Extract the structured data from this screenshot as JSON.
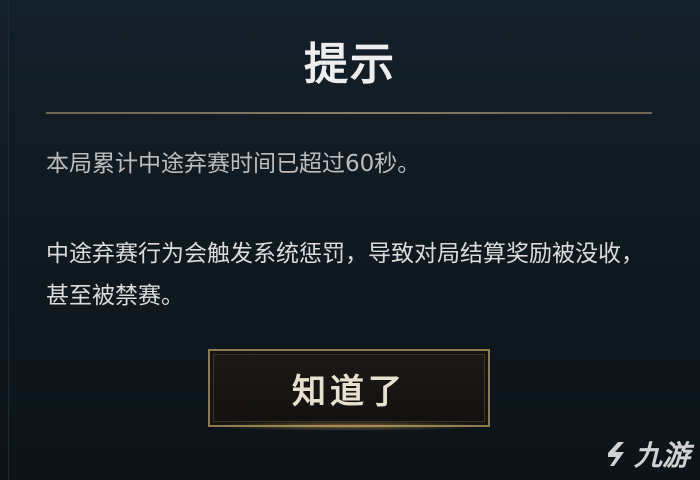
{
  "dialog": {
    "title": "提示",
    "paragraphs": [
      "本局累计中途弃赛时间已超过60秒。",
      "中途弃赛行为会触发系统惩罚，导致对局结算奖励被没收，甚至被禁赛。"
    ],
    "confirm_label": "知道了"
  },
  "watermark": {
    "text": "九游",
    "icon": "logo-icon"
  },
  "colors": {
    "background": "#0d141a",
    "divider": "#8a7e63",
    "button_border": "#8c7a4e",
    "text": "#dcdcdc"
  }
}
